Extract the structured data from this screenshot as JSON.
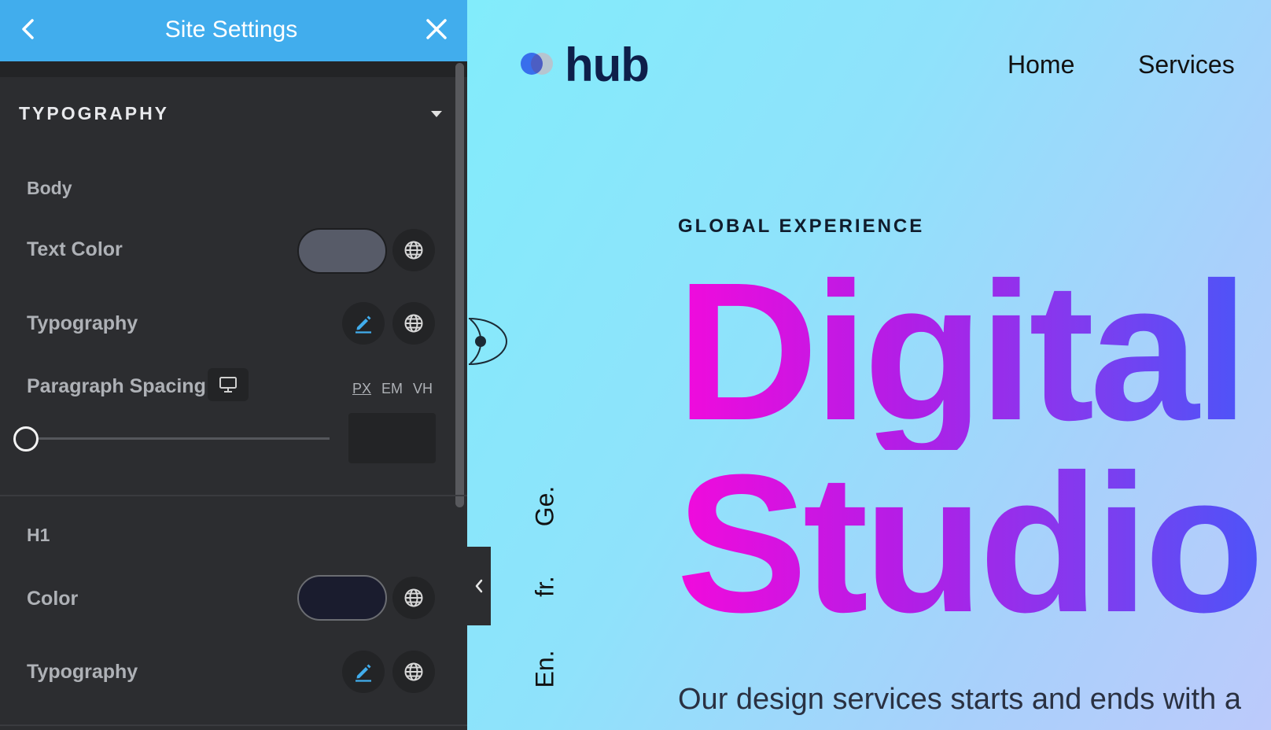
{
  "panel": {
    "title": "Site Settings",
    "section_title": "TYPOGRAPHY",
    "body": {
      "heading": "Body",
      "text_color_label": "Text Color",
      "text_color_value": "#575b68",
      "typography_label": "Typography",
      "paragraph_spacing_label": "Paragraph Spacing",
      "units": [
        "PX",
        "EM",
        "VH"
      ],
      "active_unit": "PX",
      "spacing_value": ""
    },
    "h1": {
      "heading": "H1",
      "color_label": "Color",
      "color_value": "#1a1c2e",
      "typography_label": "Typography"
    },
    "accent_color": "#41aded"
  },
  "preview": {
    "logo_text": "hub",
    "nav": [
      "Home",
      "Services"
    ],
    "languages": [
      "Ge.",
      "fr.",
      "En."
    ],
    "eyebrow": "GLOBAL EXPERIENCE",
    "hero_line1": "Digital",
    "hero_line2": "Studio",
    "tagline": "Our design services starts and ends with a"
  }
}
